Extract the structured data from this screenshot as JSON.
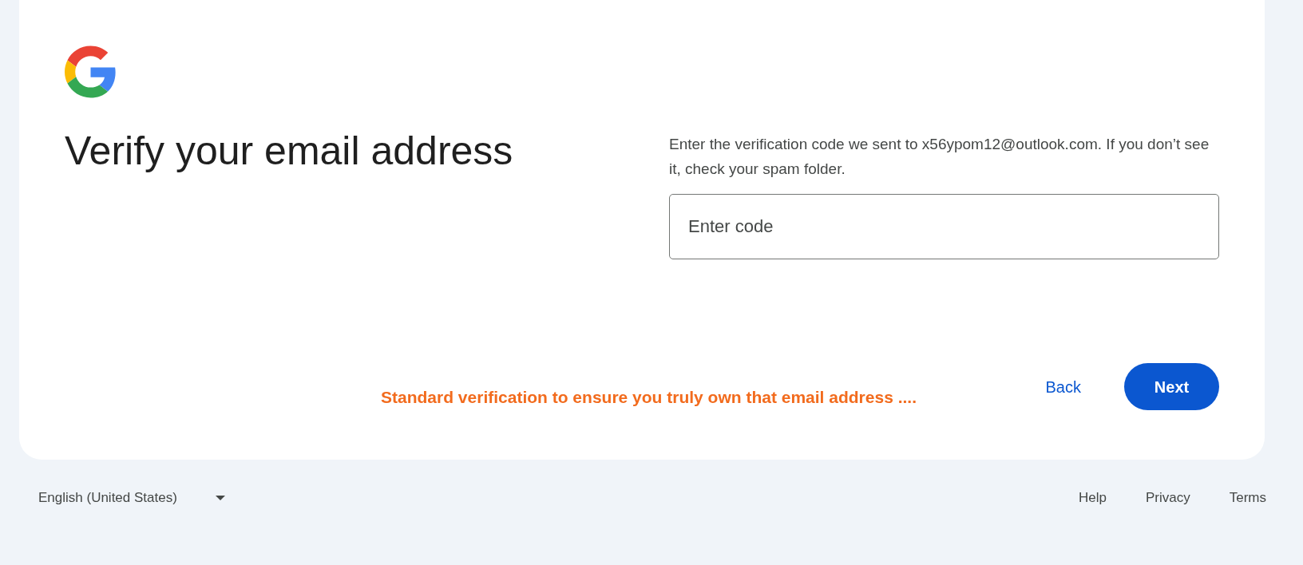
{
  "title": "Verify your email address",
  "instructions": "Enter the verification code we sent to x56ypom12@outlook.com. If you don’t see it, check your spam folder.",
  "code_field": {
    "placeholder": "Enter code"
  },
  "annotation": "Standard verification to ensure you truly own that email address ....",
  "actions": {
    "back": "Back",
    "next": "Next"
  },
  "footer": {
    "language": "English (United States)",
    "links": [
      "Help",
      "Privacy",
      "Terms"
    ]
  }
}
